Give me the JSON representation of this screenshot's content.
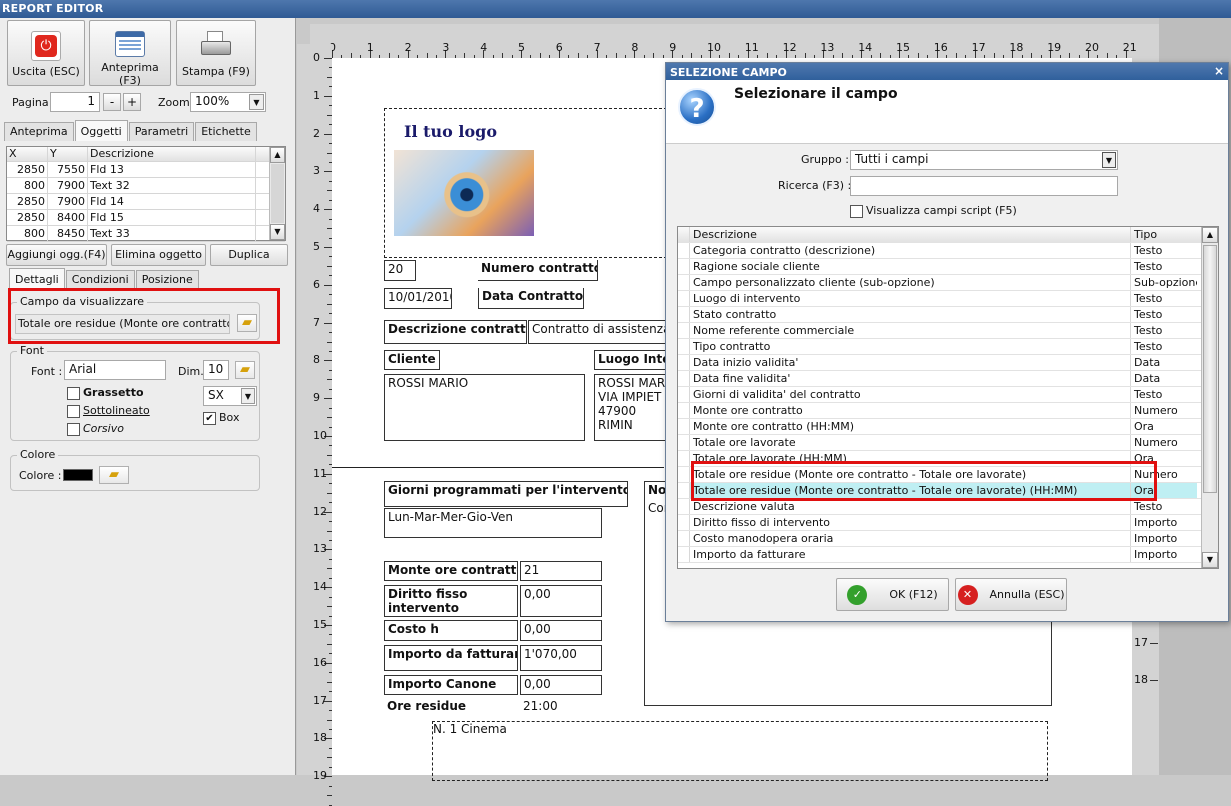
{
  "window": {
    "title": "REPORT EDITOR"
  },
  "toolbar": {
    "exit_label": "Uscita (ESC)",
    "preview_label": "Anteprima (F3)",
    "print_label": "Stampa (F9)",
    "page_label": "Pagina",
    "page_value": "1",
    "minus": "-",
    "plus": "+",
    "zoom_label": "Zoom",
    "zoom_value": "100%"
  },
  "main_tabs": [
    "Anteprima",
    "Oggetti",
    "Parametri",
    "Etichette"
  ],
  "objects_grid": {
    "headers": [
      "X",
      "Y",
      "Descrizione"
    ],
    "rows": [
      [
        "2850",
        "7550",
        "Fld 13"
      ],
      [
        "800",
        "7900",
        "Text 32"
      ],
      [
        "2850",
        "7900",
        "Fld 14"
      ],
      [
        "2850",
        "8400",
        "Fld 15"
      ],
      [
        "800",
        "8450",
        "Text 33"
      ]
    ]
  },
  "object_buttons": {
    "add": "Aggiungi ogg.(F4)",
    "delete": "Elimina oggetto",
    "duplicate": "Duplica"
  },
  "detail_tabs": [
    "Dettagli",
    "Condizioni",
    "Posizione"
  ],
  "field_group": {
    "legend": "Campo da visualizzare",
    "value": "Totale ore residue (Monte ore contratto -"
  },
  "font_group": {
    "legend": "Font",
    "font_label": "Font :",
    "font_value": "Arial",
    "dim_label": "Dim.",
    "dim_value": "10",
    "bold": "Grassetto",
    "underline": "Sottolineato",
    "italic": "Corsivo",
    "align_value": "SX",
    "box_label": "Box",
    "box_checked": true
  },
  "color_group": {
    "legend": "Colore",
    "label": "Colore :",
    "color": "#000000"
  },
  "rulers": {
    "h": [
      "0",
      "1",
      "2",
      "3",
      "4",
      "5",
      "6",
      "7",
      "8",
      "9",
      "10",
      "11",
      "12",
      "13",
      "14",
      "15",
      "16",
      "17",
      "18",
      "19",
      "20",
      "21"
    ],
    "v": [
      "0",
      "1",
      "2",
      "3",
      "4",
      "5",
      "6",
      "7",
      "8",
      "9",
      "10",
      "11",
      "12",
      "13",
      "14",
      "15",
      "16",
      "17",
      "18",
      "19"
    ],
    "v_right": [
      "15",
      "16",
      "17",
      "18"
    ]
  },
  "report": {
    "logo_text": "Il tuo logo",
    "contract_no": "20",
    "contract_no_label": "Numero contratto",
    "contract_date": "10/01/2010",
    "contract_date_label": "Data Contratto",
    "desc_label": "Descrizione contratto",
    "desc_value": "Contratto di assistenza",
    "client_label": "Cliente",
    "client_value": "ROSSI MARIO",
    "place_label": "Luogo Inte",
    "place_lines": [
      "ROSSI MAR",
      "VIA IMPIET",
      "47900 RIMIN"
    ],
    "days_label": "Giorni programmati per l'intervento",
    "days_value": "Lun-Mar-Mer-Gio-Ven",
    "notes_label": "Not",
    "notes_value": "Con",
    "hours_label": "Monte ore contratto",
    "hours_value": "21",
    "fixed_label": "Diritto fisso intervento",
    "fixed_value": "0,00",
    "cost_label": "Costo h",
    "cost_value": "0,00",
    "amount_label": "Importo da fatturare",
    "amount_value": "1'070,00",
    "fee_label": "Importo Canone",
    "fee_value": "0,00",
    "remain_label": "Ore residue",
    "remain_value": "21:00",
    "footer_text": "N. 1 Cinema"
  },
  "dialog": {
    "title": "SELEZIONE CAMPO",
    "heading": "Selezionare il campo",
    "group_label": "Gruppo :",
    "group_value": "Tutti i campi",
    "search_label": "Ricerca (F3) :",
    "search_value": "",
    "script_label": "Visualizza campi script (F5)",
    "headers": [
      "Descrizione",
      "Tipo"
    ],
    "rows": [
      [
        "Categoria contratto (descrizione)",
        "Testo"
      ],
      [
        "Ragione sociale cliente",
        "Testo"
      ],
      [
        "Campo personalizzato cliente (sub-opzione)",
        "Sub-opzione"
      ],
      [
        "Luogo di intervento",
        "Testo"
      ],
      [
        "Stato contratto",
        "Testo"
      ],
      [
        "Nome referente commerciale",
        "Testo"
      ],
      [
        "Tipo contratto",
        "Testo"
      ],
      [
        "Data inizio validita'",
        "Data"
      ],
      [
        "Data fine validita'",
        "Data"
      ],
      [
        "Giorni di validita' del contratto",
        "Testo"
      ],
      [
        "Monte ore contratto",
        "Numero"
      ],
      [
        "Monte ore contratto (HH:MM)",
        "Ora"
      ],
      [
        "Totale ore lavorate",
        "Numero"
      ],
      [
        "Totale ore lavorate (HH:MM)",
        "Ora"
      ],
      [
        "Totale ore residue (Monte ore contratto - Totale ore lavorate)",
        "Numero"
      ],
      [
        "Totale ore residue (Monte ore contratto - Totale ore lavorate) (HH:MM)",
        "Ora"
      ],
      [
        "Descrizione valuta",
        "Testo"
      ],
      [
        "Diritto fisso di intervento",
        "Importo"
      ],
      [
        "Costo manodopera oraria",
        "Importo"
      ],
      [
        "Importo da fatturare",
        "Importo"
      ]
    ],
    "selected_index": 15,
    "ok_label": "OK (F12)",
    "cancel_label": "Annulla (ESC)"
  }
}
